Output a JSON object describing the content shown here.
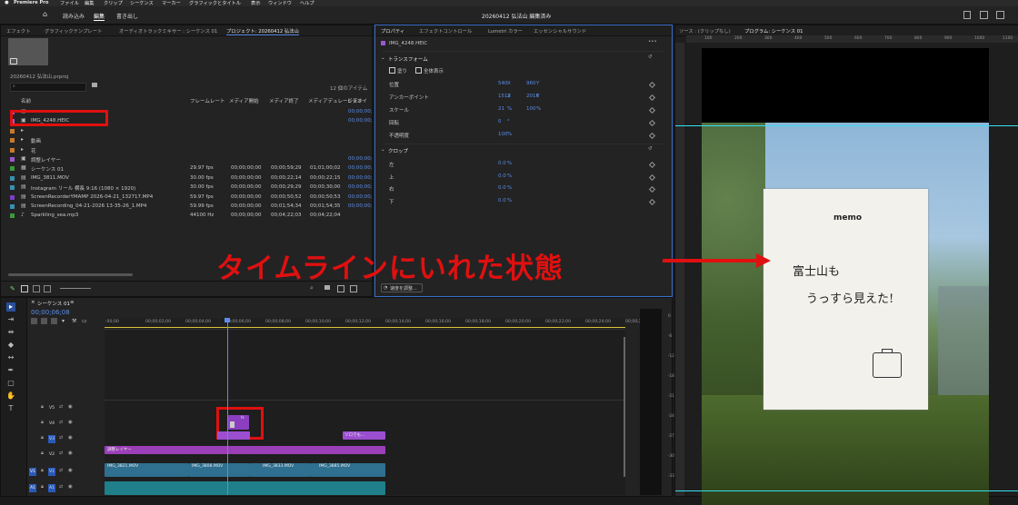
{
  "menubar": {
    "apple": "",
    "app_name": "Premiere Pro",
    "items": [
      "ファイル",
      "編集",
      "クリップ",
      "シーケンス",
      "マーカー",
      "グラフィックとタイトル",
      "表示",
      "ウィンドウ",
      "ヘルプ"
    ]
  },
  "appbar": {
    "home": "⌂",
    "nav": [
      "読み込み",
      "編集",
      "書き出し"
    ],
    "active_nav": "編集",
    "title": "20260412 弘法山  編集済み"
  },
  "left_tabs": [
    "エフェクト",
    "グラフィックテンプレート",
    "オーディオトラックミキサー : シーケンス 01",
    "プロジェクト: 20260412 弘法山"
  ],
  "project": {
    "file_name": "20260412 弘法山.prproj",
    "item_count": "12 個のアイテム",
    "columns": [
      "名前",
      "フレームレート",
      "メディア開始",
      "メディア終了",
      "メディアデュレーション",
      "ビデオイ"
    ],
    "rows": [
      {
        "color": "#9b59d0",
        "icon": "▢",
        "name": "",
        "fps": "",
        "start": "",
        "end": "",
        "dur": "",
        "vin": "00;00;00;"
      },
      {
        "color": "#9b59d0",
        "icon": "▣",
        "name": "IMG_4248.HEIC",
        "fps": "",
        "start": "",
        "end": "",
        "dur": "",
        "vin": "00;00;00;"
      },
      {
        "color": "#c77a2b",
        "icon": "▸",
        "name": "",
        "fps": "",
        "start": "",
        "end": "",
        "dur": "",
        "vin": ""
      },
      {
        "color": "#c77a2b",
        "icon": "▸",
        "name": "動画",
        "fps": "",
        "start": "",
        "end": "",
        "dur": "",
        "vin": ""
      },
      {
        "color": "#c77a2b",
        "icon": "▸",
        "name": "花",
        "fps": "",
        "start": "",
        "end": "",
        "dur": "",
        "vin": ""
      },
      {
        "color": "#9b59d0",
        "icon": "▣",
        "name": "調整レイヤー",
        "fps": "",
        "start": "",
        "end": "",
        "dur": "",
        "vin": "00;00;00;"
      },
      {
        "color": "#3a9a3a",
        "icon": "▦",
        "name": "シーケンス 01",
        "fps": "29.97 fps",
        "start": "00;00;00;00",
        "end": "00;00;59;29",
        "dur": "01;01;00;02",
        "vin": "00;00;00;"
      },
      {
        "color": "#3a8fb0",
        "icon": "▤",
        "name": "IMG_3811.MOV",
        "fps": "30.00 fps",
        "start": "00;00;00;00",
        "end": "00;00;22;14",
        "dur": "00;00;22;15",
        "vin": "00;00;00;"
      },
      {
        "color": "#3a8fb0",
        "icon": "▤",
        "name": "Instagram リール 横長 9:16 (1080 × 1920)",
        "fps": "30.00 fps",
        "start": "00;00;00;00",
        "end": "00;00;29;29",
        "dur": "00;00;30;00",
        "vin": "00;00;00;"
      },
      {
        "color": "#7b3fc2",
        "icon": "▤",
        "name": "ScreenRecorderYMAMP 2026-04-21_132717.MP4",
        "fps": "59.97 fps",
        "start": "00;00;00;00",
        "end": "00;00;50;52",
        "dur": "00;00;50;53",
        "vin": "00;00;00;"
      },
      {
        "color": "#3a8fb0",
        "icon": "▤",
        "name": "ScreenRecording_04-21-2026 13-35-26_1.MP4",
        "fps": "59.99 fps",
        "start": "00;00;00;00",
        "end": "00;01;54;34",
        "dur": "00;01;54;35",
        "vin": "00;00;00;"
      },
      {
        "color": "#3a9a3a",
        "icon": "♪",
        "name": "Sparkling_sea.mp3",
        "fps": "44100 Hz",
        "start": "00;00;00;00",
        "end": "00;04;22;03",
        "dur": "00;04;22;04",
        "vin": ""
      }
    ]
  },
  "properties": {
    "tabs": [
      "プロパティ",
      "エフェクトコントロール",
      "Lumetri カラー",
      "エッセンシャルサウンド"
    ],
    "clip_name": "IMG_4248.HEIC",
    "transform_title": "トランスフォーム",
    "fill_label": "塗り",
    "fit_label": "全体表示",
    "params": [
      {
        "label": "位置",
        "v1": "540",
        "u1": "X",
        "v2": "960",
        "u2": "Y"
      },
      {
        "label": "アンカーポイント",
        "v1": "1512",
        "u1": "X",
        "v2": "2016",
        "u2": "Y"
      },
      {
        "label": "スケール",
        "v1": "21",
        "u1": "%",
        "v2": "100",
        "u2": "%"
      },
      {
        "label": "回転",
        "v1": "0",
        "u1": "°",
        "v2": "",
        "u2": ""
      },
      {
        "label": "不透明度",
        "v1": "100",
        "u1": "%",
        "v2": "",
        "u2": ""
      }
    ],
    "crop_title": "クロップ",
    "crop": [
      {
        "label": "左",
        "v": "0.0",
        "u": "%"
      },
      {
        "label": "上",
        "v": "0.0",
        "u": "%"
      },
      {
        "label": "右",
        "v": "0.0",
        "u": "%"
      },
      {
        "label": "下",
        "v": "0.0",
        "u": "%"
      }
    ],
    "speed_button": "速度を調整..."
  },
  "source_tab": "ソース : (クリップなし)",
  "program": {
    "tab": "プログラム: シーケンス 01",
    "ruler": [
      "100",
      "200",
      "300",
      "400",
      "500",
      "600",
      "700",
      "800",
      "900",
      "1000",
      "1100"
    ]
  },
  "photo": {
    "memo": "memo",
    "line1": "富士山も",
    "line2": "うっすら見えた!"
  },
  "annotation": {
    "text": "タイムラインにいれた状態",
    "color": "#e01010"
  },
  "timeline": {
    "tab": "シーケンス 01",
    "timecode": "00;00;06;08",
    "ruler": [
      ":00;00",
      "00;00;02;00",
      "00;00;04;00",
      "00;00;06;00",
      "00;00;08;00",
      "00;00;10;00",
      "00;00;12;00",
      "00;00;14;00",
      "00;00;16;00",
      "00;00;18;00",
      "00;00;20;00",
      "00;00;22;00",
      "00;00;24;00",
      "00;00;26"
    ],
    "tracks": [
      "V5",
      "V4",
      "V3",
      "V2",
      "V1",
      "A1"
    ],
    "clips": {
      "adjust": "調整レイヤー",
      "solo": "ソロでも...",
      "v1": [
        "IMG_3821.MOV",
        "IMG_3808.MOV",
        "IMG_3833.MOV",
        "IMG_3885.MOV"
      ],
      "fx": "fx"
    },
    "vu": [
      "0",
      "-6",
      "-12",
      "-18",
      "-21",
      "-24",
      "-27",
      "-30",
      "-33"
    ]
  }
}
